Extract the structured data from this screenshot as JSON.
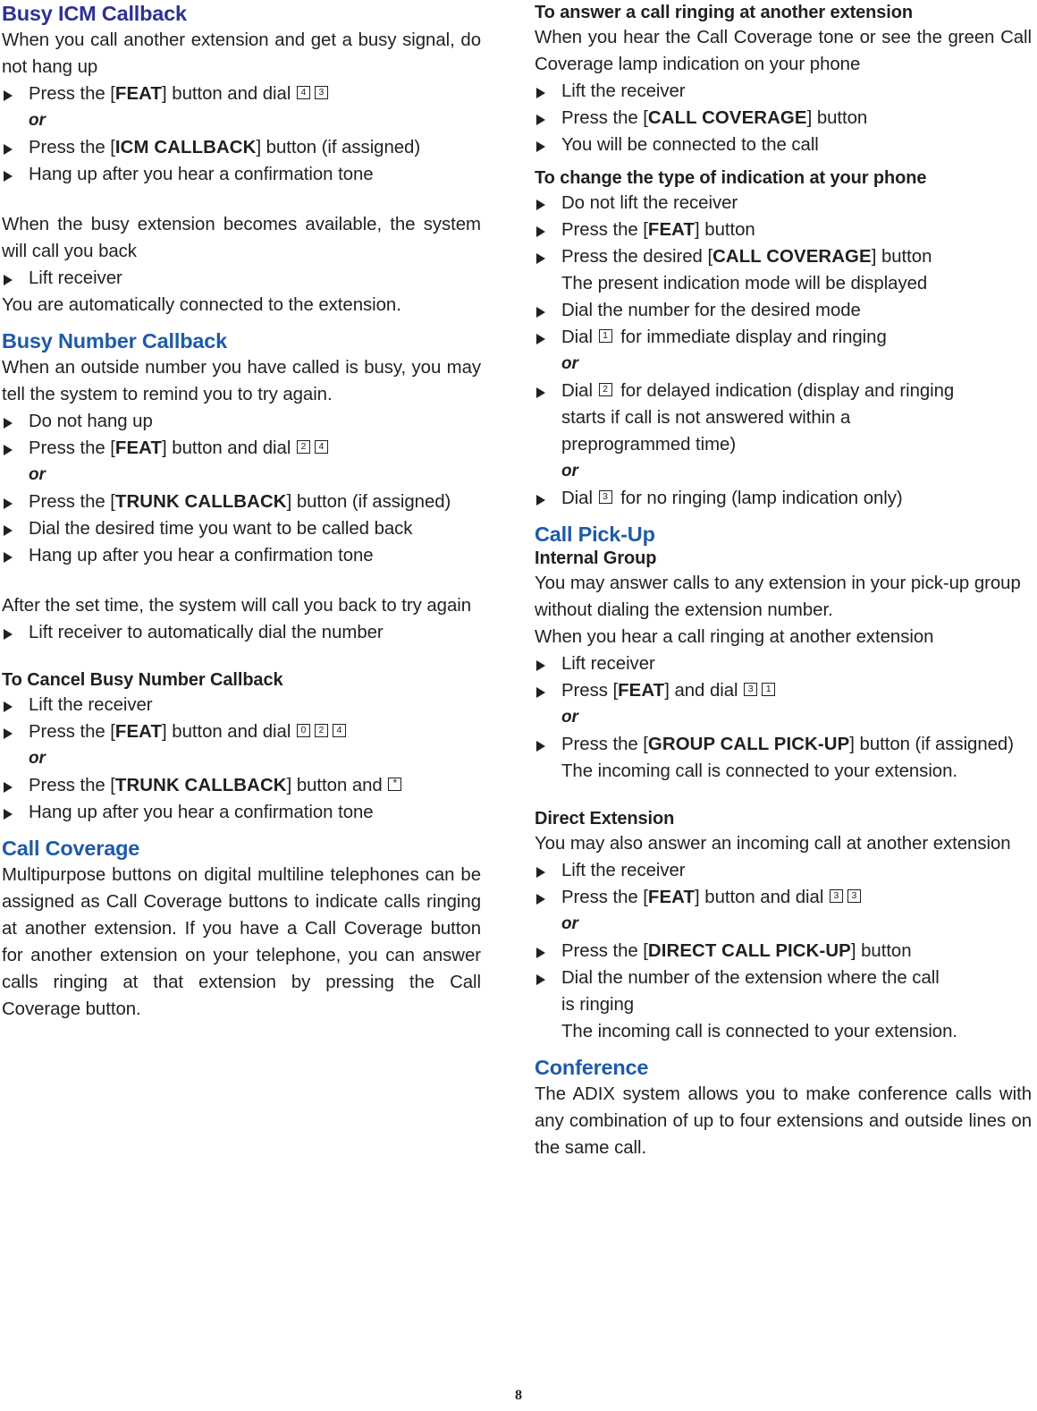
{
  "page": {
    "number": "8"
  },
  "colors": {
    "heading_blue": "#1f5ba8",
    "heading_indigo": "#2e3192",
    "text": "#231f20"
  },
  "left_column": {
    "section1": {
      "heading": "Busy ICM Callback",
      "intro": "When you call another extension and get a busy signal, do not hang up",
      "steps": [
        {
          "pre": "Press the [",
          "kw": "FEAT",
          "post": "] button and dial ",
          "keys": [
            "4",
            "3"
          ]
        },
        {
          "or": "or"
        },
        {
          "pre": "Press the [",
          "kw": "ICM CALLBACK",
          "post": "] button (if assigned)"
        },
        {
          "pre": "Hang up after you hear a confirmation tone"
        }
      ],
      "followup": "When the busy extension becomes available, the system will call you back",
      "followup_steps": [
        {
          "pre": "Lift receiver"
        }
      ],
      "closing": "You are automatically connected to the extension."
    },
    "section2": {
      "heading": "Busy Number Callback",
      "intro": "When an outside number you have called is busy, you may tell the system to remind you to try again.",
      "steps": [
        {
          "pre": "Do not hang up"
        },
        {
          "pre": "Press the [",
          "kw": "FEAT",
          "post": "] button and dial ",
          "keys": [
            "2",
            "4"
          ]
        },
        {
          "or": "or"
        },
        {
          "pre": "Press the [",
          "kw": "TRUNK CALLBACK",
          "post": "] button (if assigned)"
        },
        {
          "pre": "Dial the desired time you want to be called back"
        },
        {
          "pre": "Hang up after you hear a confirmation tone"
        }
      ],
      "followup": "After the set time, the system will call you back to try again",
      "followup_steps": [
        {
          "pre": "Lift receiver to automatically dial the number"
        }
      ],
      "subheading": "To Cancel Busy Number Callback",
      "cancel_steps": [
        {
          "pre": "Lift the receiver"
        },
        {
          "pre": "Press the [",
          "kw": "FEAT",
          "post": "] button and dial ",
          "keys": [
            "0",
            "2",
            "4"
          ]
        },
        {
          "or": "or"
        },
        {
          "pre": "Press the [",
          "kw": "TRUNK CALLBACK",
          "post": "] button and ",
          "keys": [
            "*"
          ]
        },
        {
          "pre": "Hang up after you hear a confirmation tone"
        }
      ]
    },
    "section3": {
      "heading": "Call Coverage",
      "intro": "Multipurpose buttons on digital multiline telephones can be assigned as Call Coverage buttons to indicate calls ringing at another extension.  If you have a Call Coverage button for another extension on your telephone, you can answer calls ringing at that extension by pressing the Call Coverage button."
    }
  },
  "right_column": {
    "section1": {
      "subheading": "To answer a call ringing at another extension",
      "intro": "When you hear the Call Coverage tone or see the green Call Coverage lamp indication on your phone",
      "steps": [
        {
          "pre": "Lift the receiver"
        },
        {
          "pre": "Press the [",
          "kw": "CALL COVERAGE",
          "post": "] button"
        },
        {
          "pre": "You will be connected to the call"
        }
      ]
    },
    "section2": {
      "subheading": "To change the type of indication at your phone",
      "steps": [
        {
          "pre": "Do not lift the receiver"
        },
        {
          "pre": "Press the [",
          "kw": "FEAT",
          "post": "] button"
        },
        {
          "pre": "Press the desired [",
          "kw": "CALL COVERAGE",
          "post": "] button"
        },
        {
          "cont": "The present indication mode will be displayed"
        },
        {
          "pre": "Dial the number for the desired mode"
        },
        {
          "pre": "Dial ",
          "keys": [
            "1"
          ],
          "post": " for immediate display and ringing"
        },
        {
          "or": "or"
        },
        {
          "pre": "Dial ",
          "keys": [
            "2"
          ],
          "post": " for delayed indication (display and ringing"
        },
        {
          "cont": "starts if call is not answered within a"
        },
        {
          "cont": "preprogrammed time)"
        },
        {
          "or": "or"
        },
        {
          "pre": "Dial ",
          "keys": [
            "3"
          ],
          "post": " for no ringing (lamp indication only)"
        }
      ]
    },
    "section3": {
      "heading": "Call Pick-Up",
      "subheading": "Internal Group",
      "intro": "You may answer calls to any extension in your pick-up group without dialing the extension number.",
      "intro2": "When you hear a call ringing at another extension",
      "steps": [
        {
          "pre": "Lift receiver"
        },
        {
          "pre": "Press [",
          "kw": "FEAT",
          "post": "] and dial ",
          "keys": [
            "3",
            "1"
          ]
        },
        {
          "or": "or"
        },
        {
          "pre": "Press the [",
          "kw": "GROUP CALL PICK-UP",
          "post": "] button (if assigned)"
        },
        {
          "cont": "The incoming call is connected to your extension."
        }
      ],
      "subheading2": "Direct Extension",
      "intro3": "You may also answer an incoming call at another extension",
      "steps2": [
        {
          "pre": "Lift the receiver"
        },
        {
          "pre": "Press the [",
          "kw": "FEAT",
          "post": "] button and dial ",
          "keys": [
            "3",
            "3"
          ]
        },
        {
          "or": "or"
        },
        {
          "pre": "Press the [",
          "kw": "DIRECT CALL PICK-UP",
          "post": "] button"
        },
        {
          "pre": "Dial the number of the extension where the call"
        },
        {
          "cont": "is ringing"
        },
        {
          "cont": "The incoming call is connected to your extension."
        }
      ]
    },
    "section4": {
      "heading": "Conference",
      "intro": "The ADIX system allows you to make conference calls with any combination of up to four extensions and outside lines on the same call."
    }
  }
}
